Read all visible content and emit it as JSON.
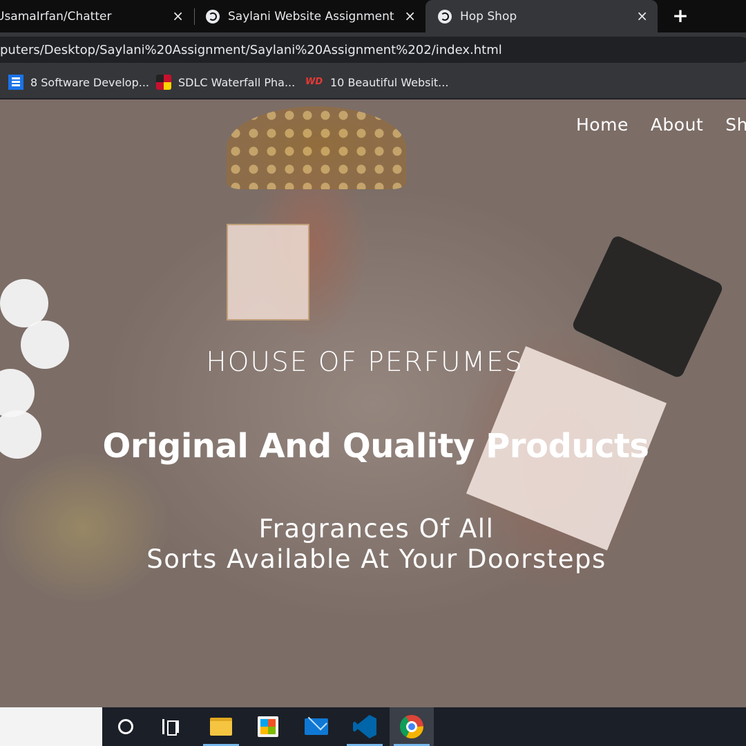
{
  "browser": {
    "tabs": [
      {
        "title": "UsamaIrfan/Chatter",
        "active": false
      },
      {
        "title": "Saylani Website Assignment",
        "active": false
      },
      {
        "title": "Hop Shop",
        "active": true
      }
    ],
    "new_tab_symbol": "+",
    "close_symbol": "×",
    "url": "puters/Desktop/Saylani%20Assignment/Saylani%20Assignment%202/index.html",
    "bookmarks": [
      {
        "label": "8 Software Develop...",
        "icon": "blue-list-icon"
      },
      {
        "label": "SDLC Waterfall Pha...",
        "icon": "maryland-flag-icon"
      },
      {
        "label": "10 Beautiful Websit...",
        "icon": "wd-logo-icon",
        "icon_text": "WD"
      }
    ]
  },
  "site": {
    "nav": [
      "Home",
      "About",
      "Shop"
    ],
    "kicker": "HOUSE OF PERFUMES",
    "headline": "Original And Quality Products",
    "sub_line_1": "Fragrances Of All",
    "sub_line_2": "Sorts Available At Your Doorsteps"
  },
  "taskbar": {
    "apps": [
      "cortana-icon",
      "task-view-icon",
      "file-explorer-icon",
      "store-icon",
      "mail-icon",
      "vscode-icon",
      "chrome-icon"
    ],
    "active_app": "chrome-icon"
  },
  "colors": {
    "tab_strip": "#0e0e0e",
    "toolbar": "#35363a",
    "taskbar": "#1b1f27",
    "hero_text": "#ffffff"
  }
}
